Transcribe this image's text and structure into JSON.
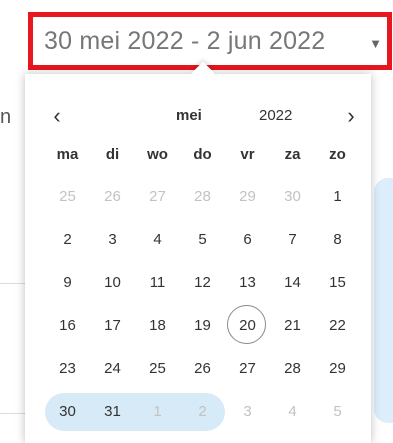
{
  "date_range": {
    "value": "30 mei 2022 - 2 jun 2022",
    "caret": "▼"
  },
  "background": {
    "partial_text": "n"
  },
  "calendar": {
    "prev_glyph": "‹",
    "next_glyph": "›",
    "month": "mei",
    "year": "2022",
    "weekdays": [
      "ma",
      "di",
      "wo",
      "do",
      "vr",
      "za",
      "zo"
    ],
    "weeks": [
      [
        {
          "d": "25",
          "muted": true
        },
        {
          "d": "26",
          "muted": true
        },
        {
          "d": "27",
          "muted": true
        },
        {
          "d": "28",
          "muted": true
        },
        {
          "d": "29",
          "muted": true
        },
        {
          "d": "30",
          "muted": true
        },
        {
          "d": "1",
          "muted": false
        }
      ],
      [
        {
          "d": "2",
          "muted": false
        },
        {
          "d": "3",
          "muted": false
        },
        {
          "d": "4",
          "muted": false
        },
        {
          "d": "5",
          "muted": false
        },
        {
          "d": "6",
          "muted": false
        },
        {
          "d": "7",
          "muted": false
        },
        {
          "d": "8",
          "muted": false
        }
      ],
      [
        {
          "d": "9",
          "muted": false
        },
        {
          "d": "10",
          "muted": false
        },
        {
          "d": "11",
          "muted": false
        },
        {
          "d": "12",
          "muted": false
        },
        {
          "d": "13",
          "muted": false
        },
        {
          "d": "14",
          "muted": false
        },
        {
          "d": "15",
          "muted": false
        }
      ],
      [
        {
          "d": "16",
          "muted": false
        },
        {
          "d": "17",
          "muted": false
        },
        {
          "d": "18",
          "muted": false
        },
        {
          "d": "19",
          "muted": false
        },
        {
          "d": "20",
          "muted": false,
          "today": true
        },
        {
          "d": "21",
          "muted": false
        },
        {
          "d": "22",
          "muted": false
        }
      ],
      [
        {
          "d": "23",
          "muted": false
        },
        {
          "d": "24",
          "muted": false
        },
        {
          "d": "25",
          "muted": false
        },
        {
          "d": "26",
          "muted": false
        },
        {
          "d": "27",
          "muted": false
        },
        {
          "d": "28",
          "muted": false
        },
        {
          "d": "29",
          "muted": false
        }
      ],
      [
        {
          "d": "30",
          "muted": false,
          "in_range": true
        },
        {
          "d": "31",
          "muted": false,
          "in_range": true
        },
        {
          "d": "1",
          "muted": true,
          "in_range": true
        },
        {
          "d": "2",
          "muted": true,
          "in_range": true
        },
        {
          "d": "3",
          "muted": true
        },
        {
          "d": "4",
          "muted": true
        },
        {
          "d": "5",
          "muted": true
        }
      ]
    ],
    "selected_range": {
      "start": "30 mei 2022",
      "end": "2 jun 2022"
    }
  },
  "colors": {
    "field_border": "#e8161e",
    "range_highlight": "#d7eaf8",
    "muted_day": "#c2c2c2"
  }
}
